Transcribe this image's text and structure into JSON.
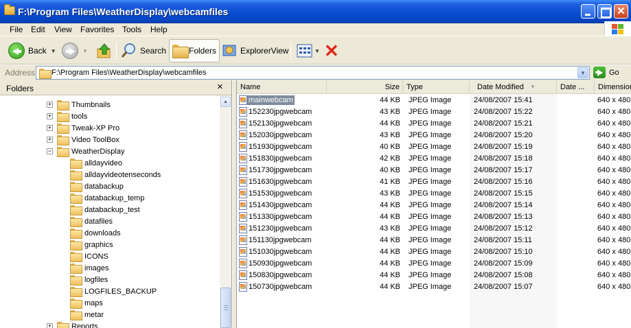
{
  "window": {
    "title": "F:\\Program Files\\WeatherDisplay\\webcamfiles"
  },
  "menu": [
    "File",
    "Edit",
    "View",
    "Favorites",
    "Tools",
    "Help"
  ],
  "toolbar": {
    "back": "Back",
    "search": "Search",
    "folders": "Folders",
    "explorer_view": "ExplorerView"
  },
  "address": {
    "label": "Address",
    "path": "F:\\Program Files\\WeatherDisplay\\webcamfiles",
    "go": "Go"
  },
  "folders_pane": {
    "title": "Folders",
    "close": "×",
    "tree": [
      {
        "label": "Thumbnails",
        "expander": "+"
      },
      {
        "label": "tools",
        "expander": "+"
      },
      {
        "label": "Tweak-XP Pro",
        "expander": "+"
      },
      {
        "label": "Video ToolBox",
        "expander": "+"
      },
      {
        "label": "WeatherDisplay",
        "expander": "−"
      },
      {
        "label": "alldayvideo",
        "expander": ""
      },
      {
        "label": "alldayvideotenseconds",
        "expander": ""
      },
      {
        "label": "databackup",
        "expander": ""
      },
      {
        "label": "databackup_temp",
        "expander": ""
      },
      {
        "label": "databackup_test",
        "expander": ""
      },
      {
        "label": "datafiles",
        "expander": ""
      },
      {
        "label": "downloads",
        "expander": ""
      },
      {
        "label": "graphics",
        "expander": ""
      },
      {
        "label": "ICONS",
        "expander": ""
      },
      {
        "label": "images",
        "expander": ""
      },
      {
        "label": "logfiles",
        "expander": ""
      },
      {
        "label": "LOGFILES_BACKUP",
        "expander": ""
      },
      {
        "label": "maps",
        "expander": ""
      },
      {
        "label": "metar",
        "expander": ""
      },
      {
        "label": "Reports",
        "expander": "+"
      }
    ]
  },
  "file_list": {
    "columns": [
      "Name",
      "Size",
      "Type",
      "Date Modified",
      "Date ...",
      "Dimensions"
    ],
    "sort_indicator": "▼",
    "files": [
      {
        "name": "mainwebcam",
        "size": "44 KB",
        "type": "JPEG Image",
        "date": "24/08/2007 15:41",
        "dims": "640 x 480",
        "selected": true
      },
      {
        "name": "152230jpgwebcam",
        "size": "43 KB",
        "type": "JPEG Image",
        "date": "24/08/2007 15:22",
        "dims": "640 x 480"
      },
      {
        "name": "152130jpgwebcam",
        "size": "44 KB",
        "type": "JPEG Image",
        "date": "24/08/2007 15:21",
        "dims": "640 x 480"
      },
      {
        "name": "152030jpgwebcam",
        "size": "43 KB",
        "type": "JPEG Image",
        "date": "24/08/2007 15:20",
        "dims": "640 x 480"
      },
      {
        "name": "151930jpgwebcam",
        "size": "40 KB",
        "type": "JPEG Image",
        "date": "24/08/2007 15:19",
        "dims": "640 x 480"
      },
      {
        "name": "151830jpgwebcam",
        "size": "42 KB",
        "type": "JPEG Image",
        "date": "24/08/2007 15:18",
        "dims": "640 x 480"
      },
      {
        "name": "151730jpgwebcam",
        "size": "40 KB",
        "type": "JPEG Image",
        "date": "24/08/2007 15:17",
        "dims": "640 x 480"
      },
      {
        "name": "151630jpgwebcam",
        "size": "41 KB",
        "type": "JPEG Image",
        "date": "24/08/2007 15:16",
        "dims": "640 x 480"
      },
      {
        "name": "151530jpgwebcam",
        "size": "43 KB",
        "type": "JPEG Image",
        "date": "24/08/2007 15:15",
        "dims": "640 x 480"
      },
      {
        "name": "151430jpgwebcam",
        "size": "44 KB",
        "type": "JPEG Image",
        "date": "24/08/2007 15:14",
        "dims": "640 x 480"
      },
      {
        "name": "151330jpgwebcam",
        "size": "44 KB",
        "type": "JPEG Image",
        "date": "24/08/2007 15:13",
        "dims": "640 x 480"
      },
      {
        "name": "151230jpgwebcam",
        "size": "43 KB",
        "type": "JPEG Image",
        "date": "24/08/2007 15:12",
        "dims": "640 x 480"
      },
      {
        "name": "151130jpgwebcam",
        "size": "44 KB",
        "type": "JPEG Image",
        "date": "24/08/2007 15:11",
        "dims": "640 x 480"
      },
      {
        "name": "151030jpgwebcam",
        "size": "44 KB",
        "type": "JPEG Image",
        "date": "24/08/2007 15:10",
        "dims": "640 x 480"
      },
      {
        "name": "150930jpgwebcam",
        "size": "44 KB",
        "type": "JPEG Image",
        "date": "24/08/2007 15:09",
        "dims": "640 x 480"
      },
      {
        "name": "150830jpgwebcam",
        "size": "44 KB",
        "type": "JPEG Image",
        "date": "24/08/2007 15:08",
        "dims": "640 x 480"
      },
      {
        "name": "150730jpgwebcam",
        "size": "44 KB",
        "type": "JPEG Image",
        "date": "24/08/2007 15:07",
        "dims": "640 x 480"
      }
    ]
  }
}
